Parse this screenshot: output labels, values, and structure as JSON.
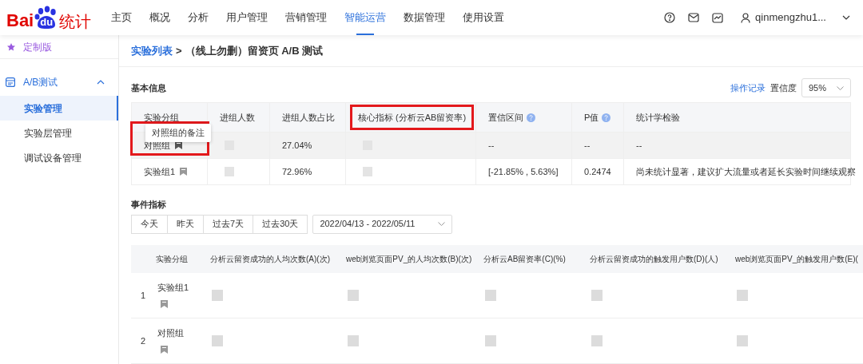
{
  "logo": {
    "prefix": "Bai",
    "paw": "du",
    "suffix": "统计"
  },
  "nav": [
    {
      "label": "主页",
      "selected": false
    },
    {
      "label": "概况",
      "selected": false
    },
    {
      "label": "分析",
      "selected": false
    },
    {
      "label": "用户管理",
      "selected": false
    },
    {
      "label": "营销管理",
      "selected": false
    },
    {
      "label": "智能运营",
      "selected": true
    },
    {
      "label": "数据管理",
      "selected": false
    },
    {
      "label": "使用设置",
      "selected": false
    }
  ],
  "user": {
    "name": "qinmengzhu1..."
  },
  "sidebar": {
    "items": [
      {
        "kind": "special",
        "label": "定制版",
        "selected": false
      },
      {
        "kind": "group",
        "label": "A/B测试",
        "expanded": true,
        "children": [
          {
            "label": "实验管理",
            "selected": true
          },
          {
            "label": "实验层管理",
            "selected": false
          },
          {
            "label": "调试设备管理",
            "selected": false
          }
        ]
      }
    ]
  },
  "breadcrumb": {
    "link": "实验列表",
    "separator": ">",
    "current": "（线上勿删）留资页 A/B 测试"
  },
  "basic_info": {
    "title": "基本信息",
    "log_link": "操作记录",
    "confidence_label": "置信度",
    "confidence_value": "95%",
    "columns": [
      {
        "label": "实验分组",
        "help": false,
        "highlighted": false
      },
      {
        "label": "进组人数",
        "help": false,
        "highlighted": false
      },
      {
        "label": "进组人数占比",
        "help": false,
        "highlighted": false
      },
      {
        "label": "核心指标 (分析云AB留资率)",
        "help": false,
        "highlighted": true
      },
      {
        "label": "置信区间",
        "help": true,
        "highlighted": false
      },
      {
        "label": "P值",
        "help": true,
        "highlighted": false
      },
      {
        "label": "统计学检验",
        "help": false,
        "highlighted": false
      }
    ],
    "rows": [
      {
        "note_active": true,
        "tooltip": "对照组的备注",
        "hovered": true,
        "highlighted": true,
        "cells": [
          "对照组",
          "",
          "27.04%",
          "",
          "--",
          "--",
          "--"
        ]
      },
      {
        "note_active": false,
        "hovered": false,
        "highlighted": false,
        "cells": [
          "实验组1",
          "",
          "72.96%",
          "",
          "[-21.85% , 5.63%]",
          "0.2474",
          "尚未统计显著，建议扩大流量或者延长实验时间继续观察"
        ]
      }
    ]
  },
  "events": {
    "title": "事件指标",
    "ranges": [
      {
        "label": "今天",
        "selected": false
      },
      {
        "label": "昨天",
        "selected": false
      },
      {
        "label": "过去7天",
        "selected": false
      },
      {
        "label": "过去30天",
        "selected": false
      }
    ],
    "date_range": "2022/04/13 - 2022/05/11",
    "columns": [
      "实验分组",
      "分析云留资成功的人均次数(A)(次)",
      "web浏览页面PV_的人均次数(B)(次)",
      "分析云AB留资率(C)(%)",
      "分析云留资成功的触发用户数(D)(人)",
      "web浏览页面PV_的触发用户数(E)("
    ],
    "rows": [
      {
        "index": "1",
        "group": "实验组1"
      },
      {
        "index": "2",
        "group": "对照组"
      }
    ]
  }
}
